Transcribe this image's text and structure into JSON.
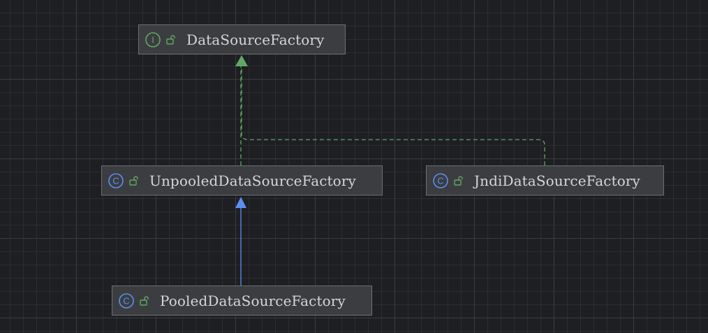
{
  "colors": {
    "background": "#1e1f22",
    "node_fill": "#3b3d40",
    "node_border": "#6e7075",
    "node_text": "#d6d6d6",
    "interface_accent": "#5fa867",
    "class_accent": "#5b8ff0",
    "implements_edge": "#5fa867",
    "extends_edge": "#5b8ff0"
  },
  "diagram": {
    "nodes": [
      {
        "id": "datasourcefactory",
        "kind": "interface",
        "kind_letter": "I",
        "icon": "interface-icon",
        "visibility_icon": "unlocked-icon",
        "label": "DataSourceFactory"
      },
      {
        "id": "unpooled",
        "kind": "class",
        "kind_letter": "C",
        "icon": "class-icon",
        "visibility_icon": "unlocked-icon",
        "label": "UnpooledDataSourceFactory"
      },
      {
        "id": "jndi",
        "kind": "class",
        "kind_letter": "C",
        "icon": "class-icon",
        "visibility_icon": "unlocked-icon",
        "label": "JndiDataSourceFactory"
      },
      {
        "id": "pooled",
        "kind": "class",
        "kind_letter": "C",
        "icon": "class-icon",
        "visibility_icon": "unlocked-icon",
        "label": "PooledDataSourceFactory"
      }
    ],
    "edges": [
      {
        "from": "unpooled",
        "to": "datasourcefactory",
        "relation": "implements",
        "style": "dashed"
      },
      {
        "from": "jndi",
        "to": "datasourcefactory",
        "relation": "implements",
        "style": "dashed"
      },
      {
        "from": "pooled",
        "to": "unpooled",
        "relation": "extends",
        "style": "solid"
      }
    ]
  }
}
